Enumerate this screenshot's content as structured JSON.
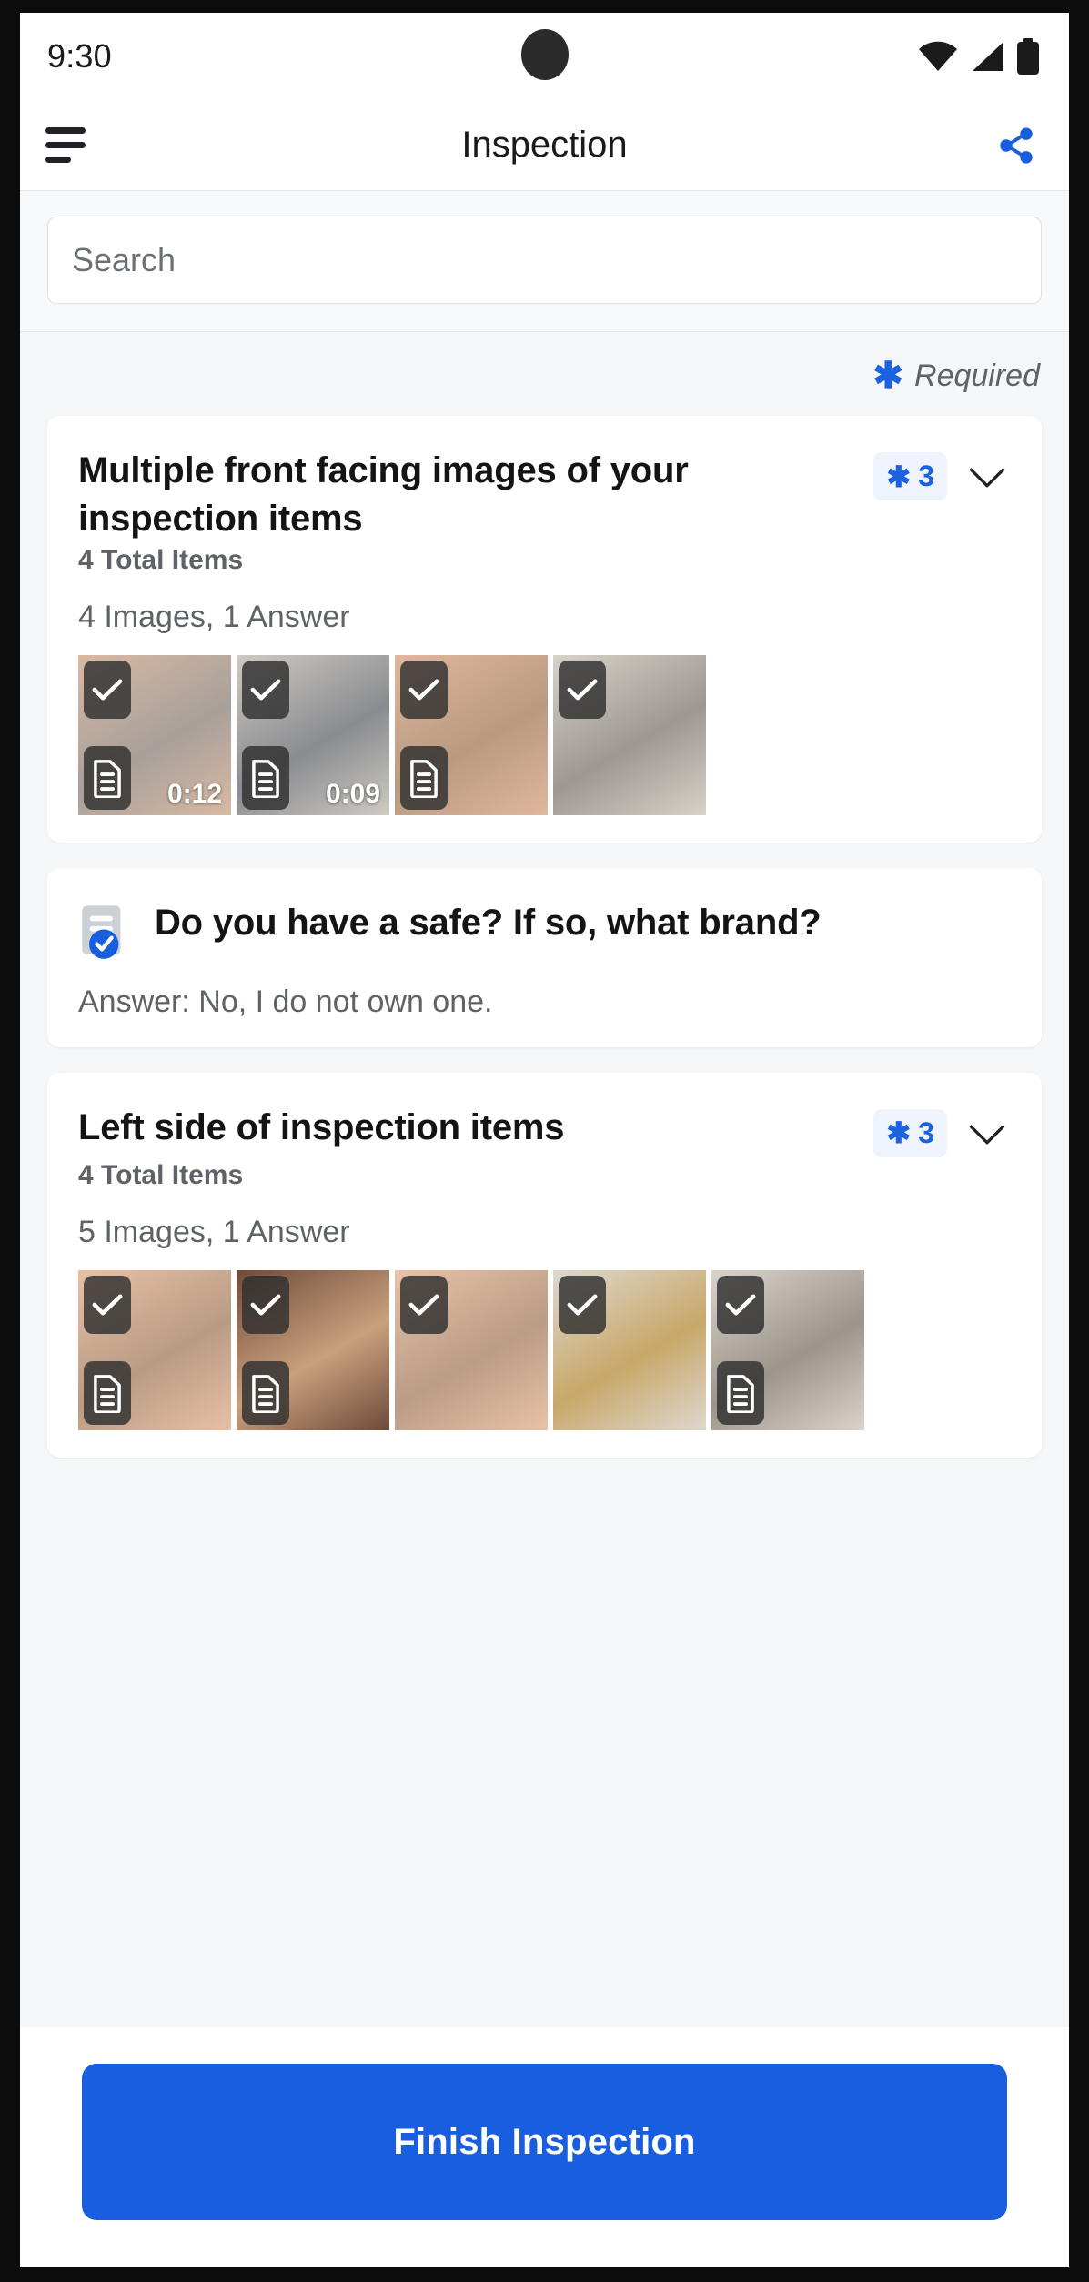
{
  "status_bar": {
    "time": "9:30",
    "icons": [
      "wifi-icon",
      "cellular-signal-icon",
      "battery-icon"
    ]
  },
  "app_bar": {
    "menu_icon": "hamburger-menu-icon",
    "title": "Inspection",
    "share_icon": "share-icon"
  },
  "search": {
    "placeholder": "Search",
    "value": ""
  },
  "legend": {
    "asterisk": "✱",
    "label": "Required"
  },
  "colors": {
    "accent_blue": "#1a5ee0",
    "badge_bg": "#eef3fd",
    "page_bg": "#f5f6f7",
    "muted_text": "#5f6368"
  },
  "cards": [
    {
      "type": "image-group",
      "title": "Multiple front facing images of your inspection items",
      "required_count": "3",
      "subtitle": "4 Total Items",
      "meta": "4 Images, 1 Answer",
      "chevron": "chevron-down-icon",
      "thumbnails": [
        {
          "check": true,
          "doc": true,
          "duration": "0:12",
          "c1": "#d9b9a3",
          "c2": "#a8a09a"
        },
        {
          "check": true,
          "doc": true,
          "duration": "0:09",
          "c1": "#cfcac3",
          "c2": "#8a8c90"
        },
        {
          "check": true,
          "doc": true,
          "duration": "",
          "c1": "#e0b79f",
          "c2": "#b99a80"
        },
        {
          "check": true,
          "doc": false,
          "duration": "",
          "c1": "#d8d2c9",
          "c2": "#9d9890"
        }
      ]
    },
    {
      "type": "question",
      "icon": "document-check-icon",
      "title": "Do you have a safe? If so, what brand?",
      "answer": "Answer: No, I do not own one."
    },
    {
      "type": "image-group",
      "title": "Left side of inspection items",
      "required_count": "3",
      "subtitle": "4 Total Items",
      "meta": "5 Images, 1 Answer",
      "chevron": "chevron-down-icon",
      "thumbnails": [
        {
          "check": true,
          "doc": true,
          "duration": "",
          "c1": "#e8c0a6",
          "c2": "#b99b84"
        },
        {
          "check": true,
          "doc": true,
          "duration": "",
          "c1": "#6e4a3a",
          "c2": "#c9a07c"
        },
        {
          "check": true,
          "doc": false,
          "duration": "",
          "c1": "#e8c2a8",
          "c2": "#bb9c86"
        },
        {
          "check": true,
          "doc": false,
          "duration": "",
          "c1": "#ded8cf",
          "c2": "#c8a86a"
        },
        {
          "check": true,
          "doc": true,
          "duration": "",
          "c1": "#d9d3ca",
          "c2": "#9c958c"
        }
      ]
    }
  ],
  "bottom": {
    "finish_label": "Finish Inspection"
  }
}
